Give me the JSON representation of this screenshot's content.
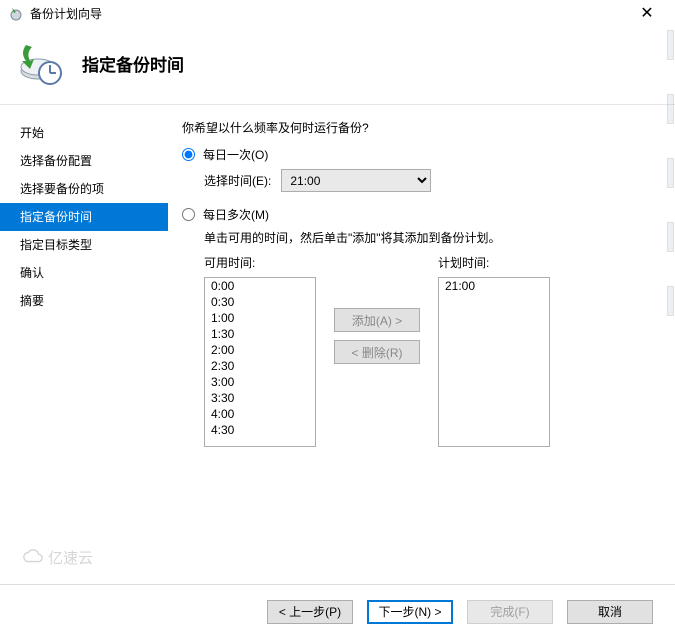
{
  "window": {
    "title": "备份计划向导"
  },
  "header": {
    "title": "指定备份时间"
  },
  "sidebar": {
    "items": [
      {
        "label": "开始"
      },
      {
        "label": "选择备份配置"
      },
      {
        "label": "选择要备份的项"
      },
      {
        "label": "指定备份时间"
      },
      {
        "label": "指定目标类型"
      },
      {
        "label": "确认"
      },
      {
        "label": "摘要"
      }
    ],
    "activeIndex": 3
  },
  "content": {
    "question": "你希望以什么频率及何时运行备份?",
    "opt_once": "每日一次(O)",
    "opt_multi": "每日多次(M)",
    "select_time_label": "选择时间(E):",
    "selected_time": "21:00",
    "multi_instruction": "单击可用的时间，然后单击\"添加\"将其添加到备份计划。",
    "avail_label": "可用时间:",
    "plan_label": "计划时间:",
    "available_times": [
      "0:00",
      "0:30",
      "1:00",
      "1:30",
      "2:00",
      "2:30",
      "3:00",
      "3:30",
      "4:00",
      "4:30"
    ],
    "plan_times": [
      "21:00"
    ],
    "add_btn": "添加(A) >",
    "remove_btn": "< 删除(R)"
  },
  "footer": {
    "prev": "< 上一步(P)",
    "next": "下一步(N) >",
    "finish": "完成(F)",
    "cancel": "取消"
  },
  "watermark": "亿速云"
}
